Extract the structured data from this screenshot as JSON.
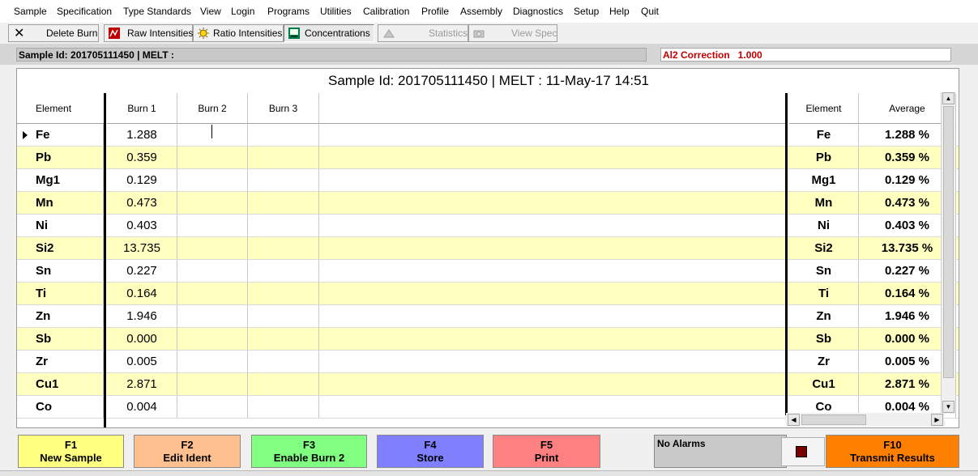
{
  "menu": [
    "Sample",
    "Specification",
    "Type Standards",
    "View",
    "Login",
    "Programs",
    "Utilities",
    "Calibration",
    "Profile",
    "Assembly",
    "Diagnostics",
    "Setup",
    "Help",
    "Quit"
  ],
  "toolbar": {
    "delete_burn": "Delete Burn",
    "raw_intensities": "Raw Intensities",
    "ratio_intensities": "Ratio Intensities",
    "concentrations": "Concentrations",
    "statistics": "Statistics",
    "view_spec": "View Spec"
  },
  "info": {
    "sample_field": "Sample Id: 201705111450 | MELT :",
    "correction": "Al2 Correction   1.000"
  },
  "grid": {
    "title": "Sample Id: 201705111450 | MELT :  11-May-17 14:51",
    "headers": {
      "element": "Element",
      "burn1": "Burn 1",
      "burn2": "Burn 2",
      "burn3": "Burn 3",
      "element_r": "Element",
      "average": "Average"
    },
    "rows": [
      {
        "element": "Fe",
        "burn1": "1.288",
        "average": "1.288 %"
      },
      {
        "element": "Pb",
        "burn1": "0.359",
        "average": "0.359 %"
      },
      {
        "element": "Mg1",
        "burn1": "0.129",
        "average": "0.129 %"
      },
      {
        "element": "Mn",
        "burn1": "0.473",
        "average": "0.473 %"
      },
      {
        "element": "Ni",
        "burn1": "0.403",
        "average": "0.403 %"
      },
      {
        "element": "Si2",
        "burn1": "13.735",
        "average": "13.735 %"
      },
      {
        "element": "Sn",
        "burn1": "0.227",
        "average": "0.227 %"
      },
      {
        "element": "Ti",
        "burn1": "0.164",
        "average": "0.164 %"
      },
      {
        "element": "Zn",
        "burn1": "1.946",
        "average": "1.946 %"
      },
      {
        "element": "Sb",
        "burn1": "0.000",
        "average": "0.000 %"
      },
      {
        "element": "Zr",
        "burn1": "0.005",
        "average": "0.005 %"
      },
      {
        "element": "Cu1",
        "burn1": "2.871",
        "average": "2.871 %"
      },
      {
        "element": "Co",
        "burn1": "0.004",
        "average": "0.004 %"
      }
    ]
  },
  "fkeys": [
    {
      "key": "F1",
      "label": "New Sample",
      "color": "#ffff80"
    },
    {
      "key": "F2",
      "label": "Edit Ident",
      "color": "#ffc090"
    },
    {
      "key": "F3",
      "label": "Enable Burn 2",
      "color": "#80ff80"
    },
    {
      "key": "F4",
      "label": "Store",
      "color": "#8080ff"
    },
    {
      "key": "F5",
      "label": "Print",
      "color": "#ff8080"
    },
    {
      "key": "F10",
      "label": "Transmit Results",
      "color": "#ff8000"
    }
  ],
  "alarm": {
    "text": "No Alarms"
  }
}
